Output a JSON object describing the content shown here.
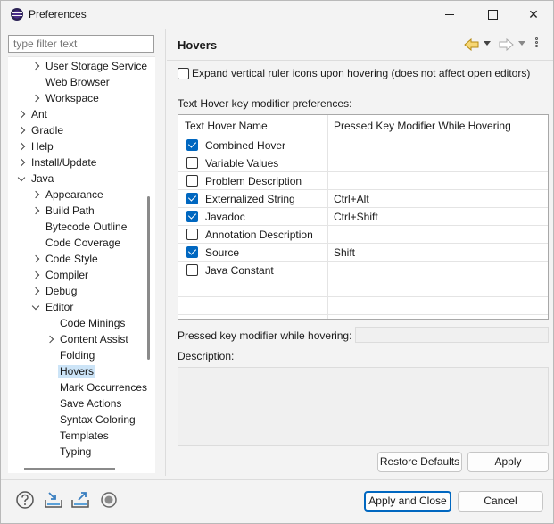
{
  "window": {
    "title": "Preferences",
    "icon": "eclipse-icon"
  },
  "filter": {
    "placeholder": "type filter text"
  },
  "tree": {
    "items": [
      {
        "label": "User Storage Service",
        "indent": 2,
        "chevron": "right"
      },
      {
        "label": "Web Browser",
        "indent": 2,
        "chevron": "none"
      },
      {
        "label": "Workspace",
        "indent": 2,
        "chevron": "right"
      },
      {
        "label": "Ant",
        "indent": 1,
        "chevron": "right"
      },
      {
        "label": "Gradle",
        "indent": 1,
        "chevron": "right"
      },
      {
        "label": "Help",
        "indent": 1,
        "chevron": "right"
      },
      {
        "label": "Install/Update",
        "indent": 1,
        "chevron": "right"
      },
      {
        "label": "Java",
        "indent": 1,
        "chevron": "down"
      },
      {
        "label": "Appearance",
        "indent": 2,
        "chevron": "right"
      },
      {
        "label": "Build Path",
        "indent": 2,
        "chevron": "right"
      },
      {
        "label": "Bytecode Outline",
        "indent": 2,
        "chevron": "none"
      },
      {
        "label": "Code Coverage",
        "indent": 2,
        "chevron": "none"
      },
      {
        "label": "Code Style",
        "indent": 2,
        "chevron": "right"
      },
      {
        "label": "Compiler",
        "indent": 2,
        "chevron": "right"
      },
      {
        "label": "Debug",
        "indent": 2,
        "chevron": "right"
      },
      {
        "label": "Editor",
        "indent": 2,
        "chevron": "down"
      },
      {
        "label": "Code Minings",
        "indent": 3,
        "chevron": "none"
      },
      {
        "label": "Content Assist",
        "indent": 3,
        "chevron": "right"
      },
      {
        "label": "Folding",
        "indent": 3,
        "chevron": "none"
      },
      {
        "label": "Hovers",
        "indent": 3,
        "chevron": "none",
        "selected": true
      },
      {
        "label": "Mark Occurrences",
        "indent": 3,
        "chevron": "none"
      },
      {
        "label": "Save Actions",
        "indent": 3,
        "chevron": "none"
      },
      {
        "label": "Syntax Coloring",
        "indent": 3,
        "chevron": "none"
      },
      {
        "label": "Templates",
        "indent": 3,
        "chevron": "none"
      },
      {
        "label": "Typing",
        "indent": 3,
        "chevron": "none"
      }
    ]
  },
  "page": {
    "title": "Hovers",
    "expand_checkbox_label": "Expand vertical ruler icons upon hovering (does not affect open editors)",
    "expand_checked": false,
    "section_label": "Text Hover key modifier preferences:",
    "table": {
      "headers": [
        "Text Hover Name",
        "Pressed Key Modifier While Hovering"
      ],
      "rows": [
        {
          "name": "Combined Hover",
          "checked": true,
          "modifier": ""
        },
        {
          "name": "Variable Values",
          "checked": false,
          "modifier": ""
        },
        {
          "name": "Problem Description",
          "checked": false,
          "modifier": ""
        },
        {
          "name": "Externalized String",
          "checked": true,
          "modifier": "Ctrl+Alt"
        },
        {
          "name": "Javadoc",
          "checked": true,
          "modifier": "Ctrl+Shift"
        },
        {
          "name": "Annotation Description",
          "checked": false,
          "modifier": ""
        },
        {
          "name": "Source",
          "checked": true,
          "modifier": "Shift"
        },
        {
          "name": "Java Constant",
          "checked": false,
          "modifier": ""
        }
      ]
    },
    "modifier_label": "Pressed key modifier while hovering:",
    "modifier_value": "",
    "description_label": "Description:",
    "restore_defaults": "Restore Defaults",
    "apply": "Apply"
  },
  "footer": {
    "apply_and_close": "Apply and Close",
    "cancel": "Cancel",
    "icons": [
      "help-icon",
      "import-icon",
      "export-icon",
      "record-icon"
    ]
  },
  "colors": {
    "accent": "#0067c0",
    "selection": "#cce4f7"
  }
}
